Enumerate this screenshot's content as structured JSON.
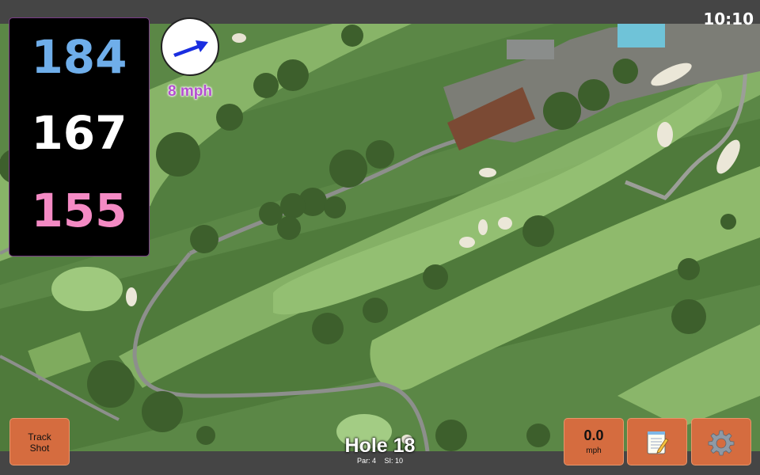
{
  "status": {
    "time": "10:10"
  },
  "distances": {
    "back": "184",
    "center": "167",
    "front": "155"
  },
  "wind": {
    "speed": "8 mph",
    "direction_icon": "wind-arrow-icon",
    "label_color": "#b44fd0"
  },
  "hole": {
    "title": "Hole 18",
    "par_label": "Par: 4",
    "stroke_index_label": "SI: 10"
  },
  "buttons": {
    "track_shot_line1": "Track",
    "track_shot_line2": "Shot",
    "speed_value": "0.0",
    "speed_unit": "mph",
    "notes_icon": "notepad-icon",
    "settings_icon": "gear-icon"
  },
  "colors": {
    "accent_orange": "#d56c3f",
    "back_distance": "#6faeea",
    "center_distance": "#ffffff",
    "front_distance": "#f48ac4"
  }
}
